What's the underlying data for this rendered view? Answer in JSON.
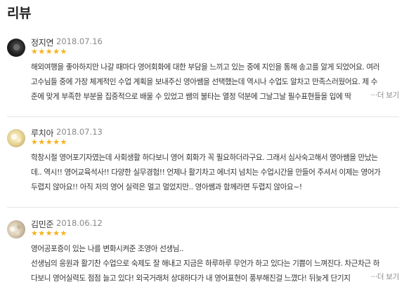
{
  "section": {
    "title": "리뷰"
  },
  "reviews": [
    {
      "name": "정지연",
      "date": "2018.07.16",
      "stars": "★★★★★",
      "rating": 5,
      "lines": [
        "해외여행을 좋아하지만 나갈 때마다 영어회화에 대한 부담을 느끼고 있는 중에 지인을 통해 송고를 알게 되었어요. 여러",
        "고수님들 중에 가장 체계적인 수업 계획을 보내주신 영아쌤을 선택했는데 역시나 수업도 알차고 만족스러웠어요. 제 수",
        "준에 맞게 부족한 부분을 집중적으로 배울 수 있었고 쌤의 불타는 열정 덕분에 그날그날 필수표현들을 입에 딱"
      ],
      "more": "···더 보기"
    },
    {
      "name": "루치아",
      "date": "2018.07.13",
      "stars": "★★★★★",
      "rating": 5,
      "lines": [
        "학창시절 영어포기자였는데 사회생활 하다보니 영어 회화가 꼭 필요하더라구요. 그래서 심사숙고해서 영아쌤을 만났는",
        "데.. 역시!! 영어교육석사!! 다양한 실무경험!! 언제나 활기차고 에너지 넘치는 수업시간을 만들어 주셔서 이제는 영어가",
        "두렵지 않아요!! 아직 저의 영어 실력은 멀고 멀었지만.. 영아쌤과 함께라면 두렵지 않아요~!"
      ],
      "more": ""
    },
    {
      "name": "김민준",
      "date": "2018.06.12",
      "stars": "★★★★★",
      "rating": 5,
      "lines": [
        "영어공포증이 있는 나를 변화시켜준 조영아 선생님..",
        "선생님의 응원과 활기찬 수업으로 숙제도 잘 해내고 지금은 하루하루 무언가 하고 있다는 기쁨이 느껴진다. 차근차근 하",
        "다보니 영어실력도 점점 늘고 있다! 외국거래처 상대하다가 내 영어표현이 풍부해진걸 느꼈다! 뒤늦게 단기지"
      ],
      "more": "···더 보기"
    }
  ],
  "colors": {
    "star": "#f5b21b",
    "date": "#888888",
    "text": "#333333",
    "divider": "#e6e6e6"
  }
}
